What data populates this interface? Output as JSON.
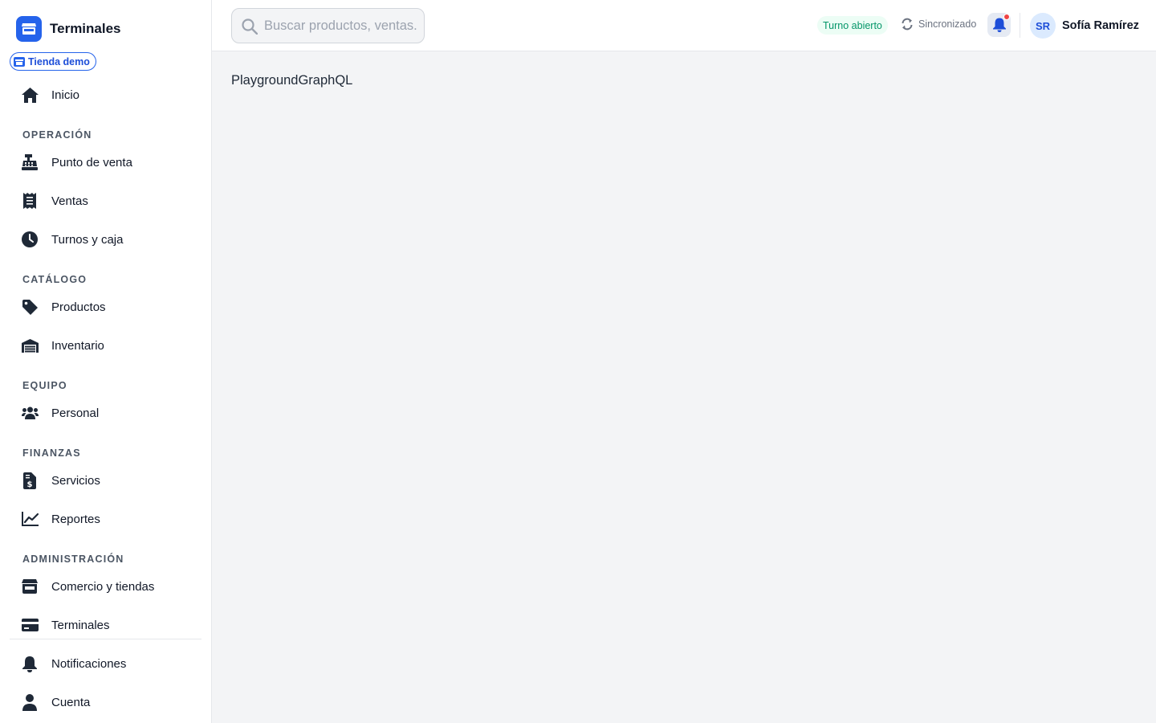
{
  "sidebar": {
    "brand": {
      "title": "Terminales",
      "logo_icon": "store-icon",
      "accent": "#2563eb"
    },
    "store_chip": {
      "label": "Tienda demo",
      "icon": "store-icon"
    },
    "home": {
      "label": "Inicio",
      "icon": "home-icon"
    },
    "sections": {
      "operacion": {
        "title": "OPERACIÓN",
        "items": [
          {
            "label": "Punto de venta",
            "icon": "cash-register-icon"
          },
          {
            "label": "Ventas",
            "icon": "receipt-icon"
          },
          {
            "label": "Turnos y caja",
            "icon": "clock-icon"
          }
        ]
      },
      "catalogo": {
        "title": "CATÁLOGO",
        "items": [
          {
            "label": "Productos",
            "icon": "tag-icon"
          },
          {
            "label": "Inventario",
            "icon": "warehouse-icon"
          }
        ]
      },
      "equipo": {
        "title": "EQUIPO",
        "items": [
          {
            "label": "Personal",
            "icon": "users-icon"
          }
        ]
      },
      "finanzas": {
        "title": "FINANZAS",
        "items": [
          {
            "label": "Servicios",
            "icon": "invoice-dollar-icon"
          },
          {
            "label": "Reportes",
            "icon": "line-chart-icon"
          }
        ]
      },
      "administracion": {
        "title": "ADMINISTRACIÓN",
        "items": [
          {
            "label": "Comercio y tiendas",
            "icon": "store-icon"
          },
          {
            "label": "Terminales",
            "icon": "credit-card-icon"
          }
        ]
      }
    },
    "footer_items": [
      {
        "label": "Notificaciones",
        "icon": "bell-icon"
      },
      {
        "label": "Cuenta",
        "icon": "user-icon"
      }
    ]
  },
  "header": {
    "search": {
      "placeholder": "Buscar productos, ventas...",
      "value": ""
    },
    "shift_badge": "Turno abierto",
    "sync_status": "Sincronizado",
    "notifications": {
      "icon": "bell-icon",
      "has_unread": true
    },
    "user": {
      "initials": "SR",
      "name": "Sofía Ramírez"
    }
  },
  "main": {
    "content_text": "PlaygroundGraphQL"
  },
  "colors": {
    "primary": "#2563eb",
    "success": "#059669",
    "success_bg": "#ecfdf5",
    "danger": "#ef4444",
    "page_bg": "#f3f4f6"
  }
}
